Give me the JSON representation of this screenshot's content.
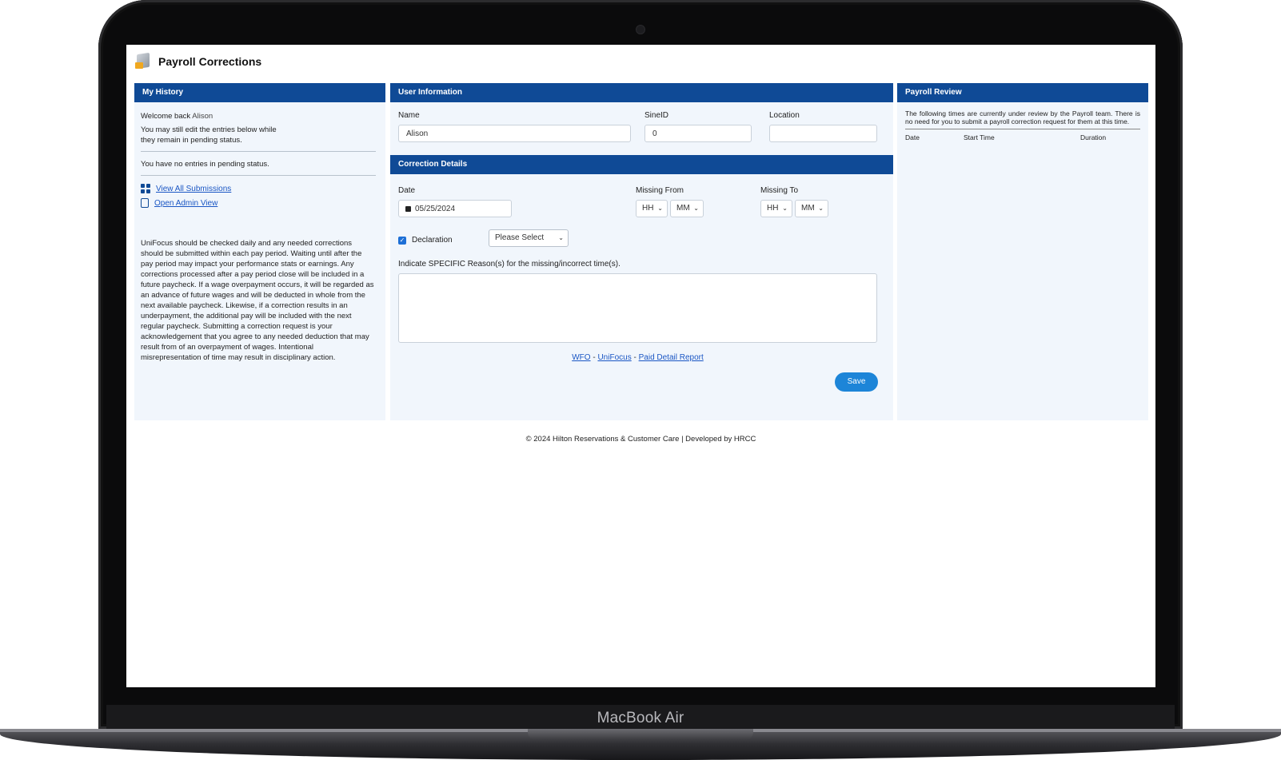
{
  "device": {
    "brand": "MacBook Air"
  },
  "app": {
    "title": "Payroll Corrections"
  },
  "history": {
    "header": "My History",
    "welcome_prefix": "Welcome back",
    "welcome_name": "Alison",
    "edit_note_line1": "You may still edit the entries below while",
    "edit_note_line2": "they remain in pending status.",
    "no_entries": "You have no entries in pending status.",
    "view_all": "View All Submissions",
    "admin_view": "Open Admin View",
    "policy": "UniFocus should be checked daily and any needed corrections should be submitted within each pay period. Waiting until after the pay period may impact your performance stats or earnings. Any corrections processed after a pay period close will be included in a future paycheck. If a wage overpayment occurs, it will be regarded as an advance of future wages and will be deducted in whole from the next available paycheck. Likewise, if a correction results in an underpayment, the additional pay will be included with the next regular paycheck. Submitting a correction request is your acknowledgement that you agree to any needed deduction that may result from of an overpayment of wages. Intentional misrepresentation of time may result in disciplinary action."
  },
  "user_info": {
    "header": "User Information",
    "name_label": "Name",
    "name_value": "Alison",
    "sineid_label": "SineID",
    "sineid_value": "0",
    "location_label": "Location",
    "location_value": ""
  },
  "correction": {
    "header": "Correction Details",
    "date_label": "Date",
    "date_value": "05/25/2024",
    "missing_from_label": "Missing From",
    "missing_to_label": "Missing To",
    "hh": "HH",
    "mm": "MM",
    "declaration_label": "Declaration",
    "declaration_checked": true,
    "declaration_select": "Please Select",
    "reason_label": "Indicate SPECIFIC Reason(s) for the missing/incorrect time(s).",
    "reason_value": "",
    "links": {
      "wfo": "WFO",
      "sep": "-",
      "unifocus": "UniFocus",
      "paid": "Paid Detail Report"
    },
    "save": "Save"
  },
  "review": {
    "header": "Payroll Review",
    "note": "The following times are currently under review by the Payroll team. There is no need for you to submit a payroll correction request for them at this time.",
    "columns": [
      "Date",
      "Start Time",
      "Duration"
    ]
  },
  "footer": {
    "text": "© 2024 Hilton Reservations & Customer Care | Developed by HRCC"
  },
  "colors": {
    "header_blue": "#0f4a96",
    "panel_bg": "#f1f6fc",
    "save_blue": "#1d85d8",
    "link_blue": "#1a56c4"
  }
}
